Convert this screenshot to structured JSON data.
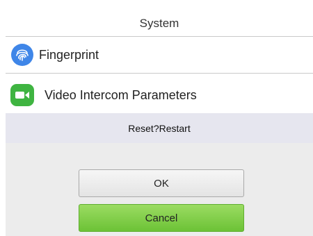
{
  "header": {
    "title": "System"
  },
  "menu": {
    "items": [
      {
        "label": "Fingerprint",
        "icon": "fingerprint-icon",
        "icon_color": "#3f86e8"
      },
      {
        "label": "Video Intercom Parameters",
        "icon": "video-camera-icon",
        "icon_color": "#3fb441"
      }
    ]
  },
  "dialog": {
    "message": "Reset?Restart",
    "ok_label": "OK",
    "cancel_label": "Cancel",
    "cancel_color": "#6cc236"
  }
}
